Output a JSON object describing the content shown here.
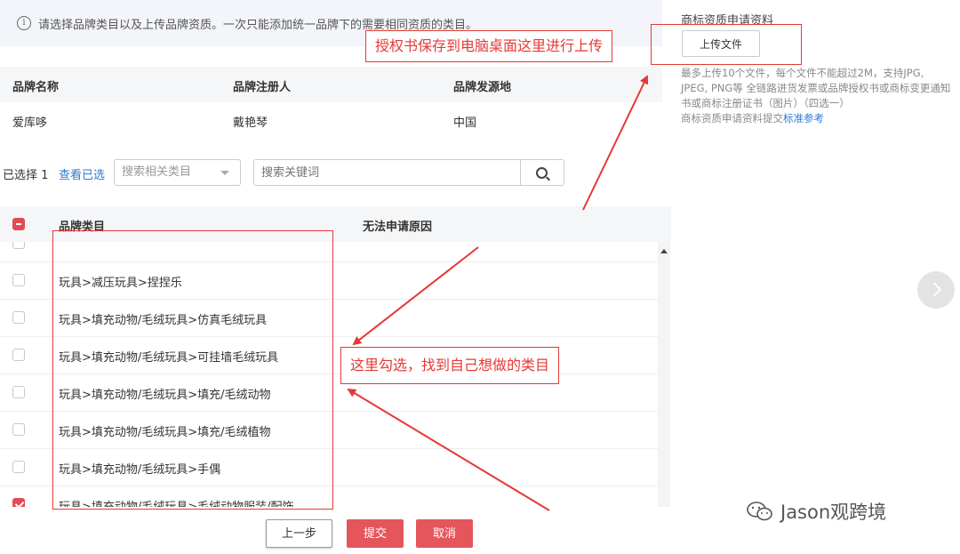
{
  "notice": {
    "text": "请选择品牌类目以及上传品牌资质。一次只能添加统一品牌下的需要相同资质的类目。"
  },
  "brand_table": {
    "headers": [
      "品牌名称",
      "品牌注册人",
      "品牌发源地"
    ],
    "row": [
      "爱库哆",
      "戴艳琴",
      "中国"
    ]
  },
  "filters": {
    "selected_count": "已选择 1",
    "view_selected": "查看已选",
    "category_placeholder": "搜索相关类目",
    "keyword_placeholder": "搜索关键词"
  },
  "category_table": {
    "headers": [
      "品牌类目",
      "无法申请原因"
    ],
    "rows": [
      {
        "label": "玩具>减压玩具>捏捏乐",
        "checked": false
      },
      {
        "label": "玩具>填充动物/毛绒玩具>仿真毛绒玩具",
        "checked": false
      },
      {
        "label": "玩具>填充动物/毛绒玩具>可挂墙毛绒玩具",
        "checked": false
      },
      {
        "label": "玩具>填充动物/毛绒玩具>填充/毛绒动物",
        "checked": false
      },
      {
        "label": "玩具>填充动物/毛绒玩具>填充/毛绒植物",
        "checked": false
      },
      {
        "label": "玩具>填充动物/毛绒玩具>手偶",
        "checked": false
      },
      {
        "label": "玩具>填充动物/毛绒玩具>毛绒动物服装/配饰",
        "checked": true
      }
    ]
  },
  "buttons": {
    "prev": "上一步",
    "submit": "提交",
    "cancel": "取消"
  },
  "right_panel": {
    "title": "商标资质申请资料",
    "upload": "上传文件",
    "hint": "最多上传10个文件，每个文件不能超过2M，支持JPG, JPEG, PNG等 全链路进货发票或品牌授权书或商标变更通知书或商标注册证书（图片）（四选一）",
    "hint2": "商标资质申请资料提交",
    "hint_link": "标准参考"
  },
  "annotations": {
    "upload_note": "授权书保存到电脑桌面这里进行上传",
    "check_note": "这里勾选，找到自己想做的类目"
  },
  "watermark": "Jason观跨境",
  "colors": {
    "accent_red": "#e5555c",
    "annotation_red": "#e53935",
    "link_blue": "#2a7bd5"
  }
}
